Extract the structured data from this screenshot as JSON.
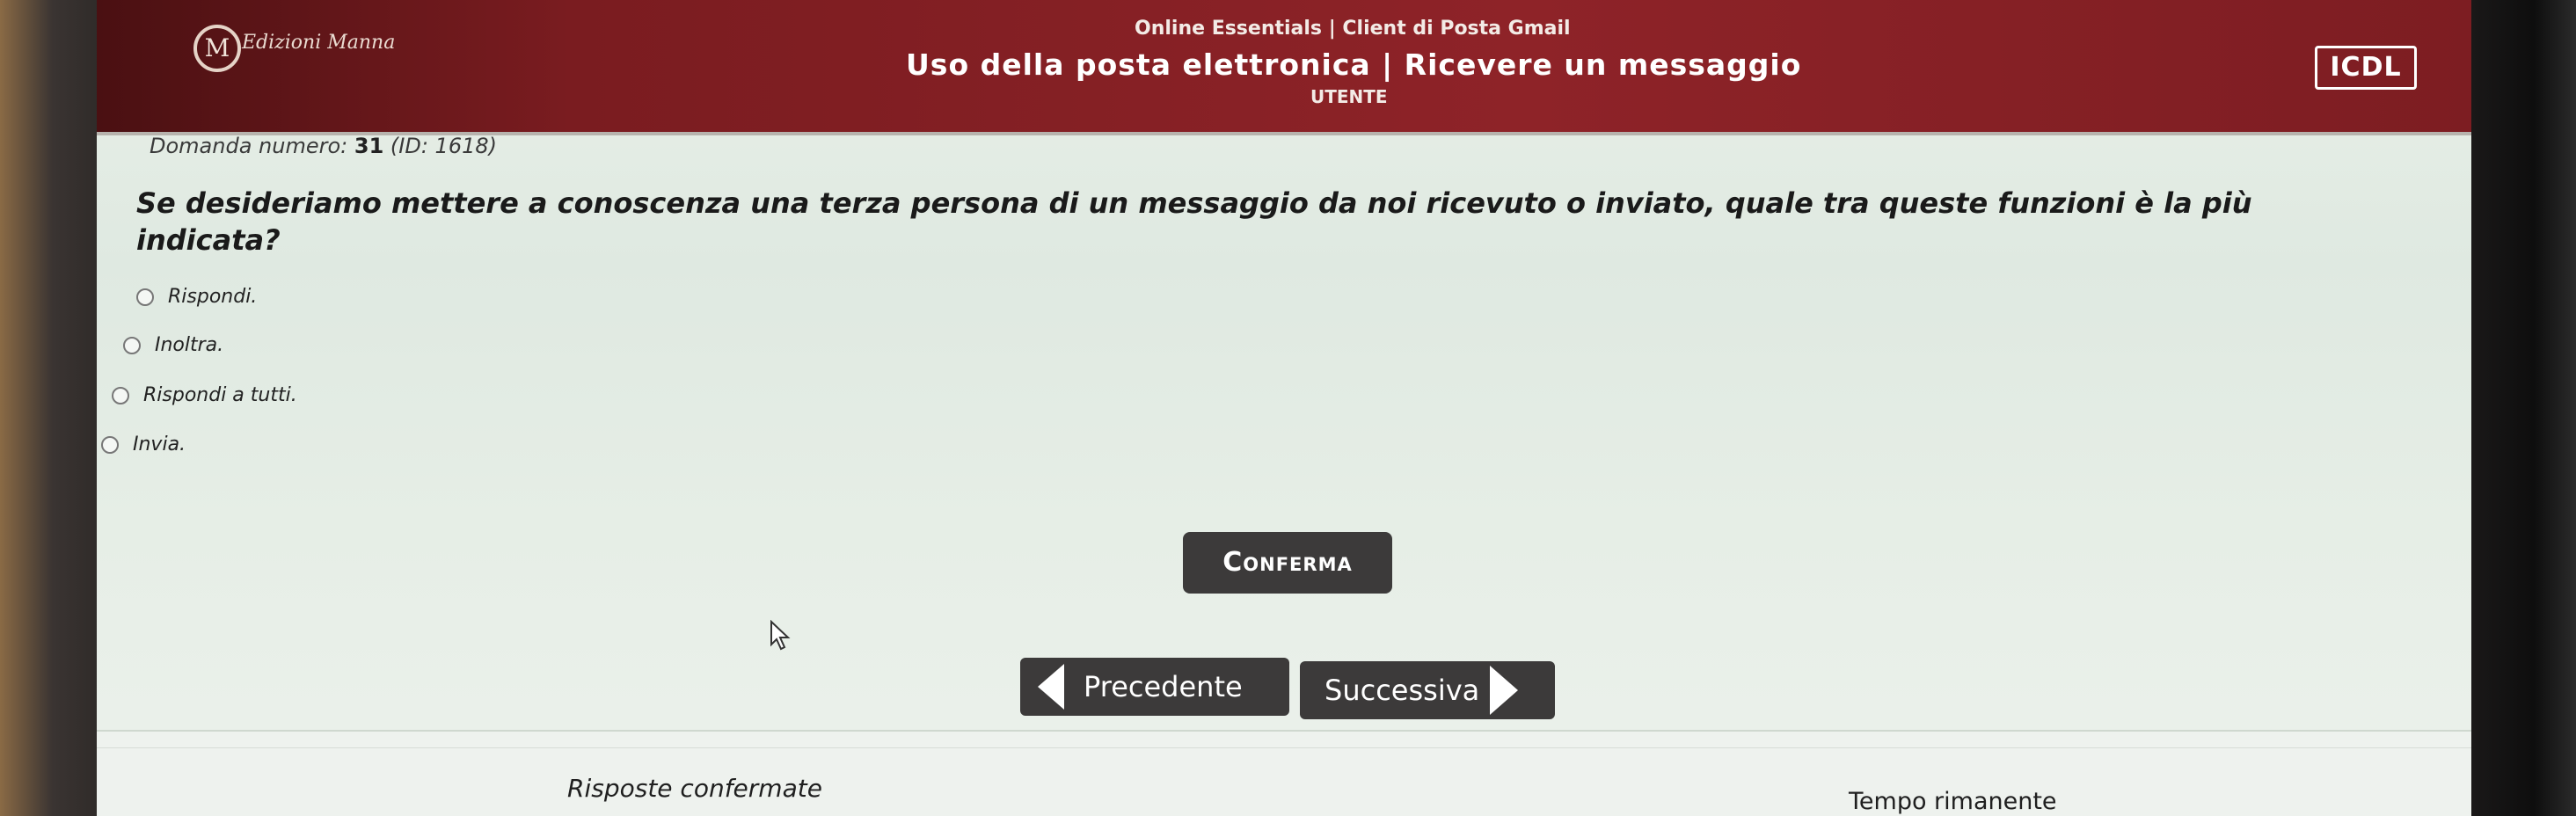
{
  "header": {
    "logo_text": "Edizioni Manna",
    "subtitle": "Online Essentials | Client di Posta Gmail",
    "title": "Uso della posta elettronica | Ricevere un messaggio",
    "role": "UTENTE",
    "badge": "ICDL"
  },
  "question": {
    "number_label": "Domanda numero:",
    "number": "31",
    "id_label": "(ID: 1618)",
    "text": "Se desideriamo mettere a conoscenza una terza persona di un messaggio da noi ricevuto o inviato, quale tra queste funzioni è la più indicata?"
  },
  "options": [
    {
      "label": "Rispondi."
    },
    {
      "label": "Inoltra."
    },
    {
      "label": "Rispondi a tutti."
    },
    {
      "label": "Invia."
    }
  ],
  "actions": {
    "confirm_label": "Conferma",
    "prev_label": "Precedente",
    "next_label": "Successiva"
  },
  "footer": {
    "confirmed_label": "Risposte confermate",
    "time_label": "Tempo rimanente"
  },
  "colors": {
    "header_bg": "#8e2328",
    "button_bg": "#3c3a3a",
    "page_bg": "#e6eee6"
  }
}
